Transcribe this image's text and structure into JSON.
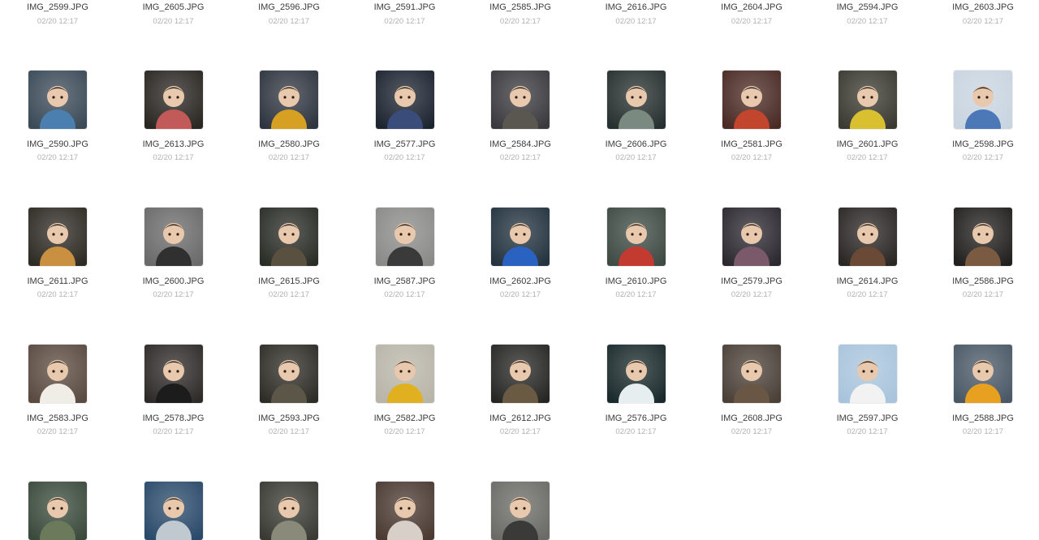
{
  "colors": {
    "filename_text": "#3c3c3c",
    "timestamp_text": "#b0b0b0",
    "background": "#ffffff"
  },
  "files": [
    {
      "name": "IMG_2599.JPG",
      "time": "02/20 12:17",
      "thumb": null
    },
    {
      "name": "IMG_2605.JPG",
      "time": "02/20 12:17",
      "thumb": null
    },
    {
      "name": "IMG_2596.JPG",
      "time": "02/20 12:17",
      "thumb": null
    },
    {
      "name": "IMG_2591.JPG",
      "time": "02/20 12:17",
      "thumb": null
    },
    {
      "name": "IMG_2585.JPG",
      "time": "02/20 12:17",
      "thumb": null
    },
    {
      "name": "IMG_2616.JPG",
      "time": "02/20 12:17",
      "thumb": null
    },
    {
      "name": "IMG_2604.JPG",
      "time": "02/20 12:17",
      "thumb": null
    },
    {
      "name": "IMG_2594.JPG",
      "time": "02/20 12:17",
      "thumb": null
    },
    {
      "name": "IMG_2603.JPG",
      "time": "02/20 12:17",
      "thumb": null
    },
    {
      "name": "IMG_2590.JPG",
      "time": "02/20 12:17",
      "thumb": {
        "bg": "#3b4a58",
        "accent": "#4a7fb0"
      }
    },
    {
      "name": "IMG_2613.JPG",
      "time": "02/20 12:17",
      "thumb": {
        "bg": "#2a2622",
        "accent": "#c25a5a"
      }
    },
    {
      "name": "IMG_2580.JPG",
      "time": "02/20 12:17",
      "thumb": {
        "bg": "#2f3540",
        "accent": "#d6a022"
      }
    },
    {
      "name": "IMG_2577.JPG",
      "time": "02/20 12:17",
      "thumb": {
        "bg": "#1c2430",
        "accent": "#3a4c7a"
      }
    },
    {
      "name": "IMG_2584.JPG",
      "time": "02/20 12:17",
      "thumb": {
        "bg": "#3a3a3e",
        "accent": "#5a5650"
      }
    },
    {
      "name": "IMG_2606.JPG",
      "time": "02/20 12:17",
      "thumb": {
        "bg": "#26302e",
        "accent": "#7a8a80"
      }
    },
    {
      "name": "IMG_2581.JPG",
      "time": "02/20 12:17",
      "thumb": {
        "bg": "#4a2a24",
        "accent": "#c2452e"
      }
    },
    {
      "name": "IMG_2601.JPG",
      "time": "02/20 12:17",
      "thumb": {
        "bg": "#3a3a32",
        "accent": "#d8c030"
      }
    },
    {
      "name": "IMG_2598.JPG",
      "time": "02/20 12:17",
      "thumb": {
        "bg": "#c8d4e0",
        "accent": "#4c78b8"
      }
    },
    {
      "name": "IMG_2611.JPG",
      "time": "02/20 12:17",
      "thumb": {
        "bg": "#2e2a24",
        "accent": "#c89040"
      }
    },
    {
      "name": "IMG_2600.JPG",
      "time": "02/20 12:17",
      "thumb": {
        "bg": "#6a6a6a",
        "accent": "#303030"
      }
    },
    {
      "name": "IMG_2615.JPG",
      "time": "02/20 12:17",
      "thumb": {
        "bg": "#2a2c26",
        "accent": "#5a5040"
      }
    },
    {
      "name": "IMG_2587.JPG",
      "time": "02/20 12:17",
      "thumb": {
        "bg": "#8a8a88",
        "accent": "#3a3a3a"
      }
    },
    {
      "name": "IMG_2602.JPG",
      "time": "02/20 12:17",
      "thumb": {
        "bg": "#23333f",
        "accent": "#2a62c2"
      }
    },
    {
      "name": "IMG_2610.JPG",
      "time": "02/20 12:17",
      "thumb": {
        "bg": "#3e4a44",
        "accent": "#c23a30"
      }
    },
    {
      "name": "IMG_2579.JPG",
      "time": "02/20 12:17",
      "thumb": {
        "bg": "#2c2830",
        "accent": "#7a5a6a"
      }
    },
    {
      "name": "IMG_2614.JPG",
      "time": "02/20 12:17",
      "thumb": {
        "bg": "#2a2624",
        "accent": "#6a4a36"
      }
    },
    {
      "name": "IMG_2586.JPG",
      "time": "02/20 12:17",
      "thumb": {
        "bg": "#22201e",
        "accent": "#7a5a40"
      }
    },
    {
      "name": "IMG_2583.JPG",
      "time": "02/20 12:17",
      "thumb": {
        "bg": "#5a4a40",
        "accent": "#f0ece6"
      }
    },
    {
      "name": "IMG_2578.JPG",
      "time": "02/20 12:17",
      "thumb": {
        "bg": "#2e2a28",
        "accent": "#1c1c1c"
      }
    },
    {
      "name": "IMG_2593.JPG",
      "time": "02/20 12:17",
      "thumb": {
        "bg": "#2e2c26",
        "accent": "#5c5648"
      }
    },
    {
      "name": "IMG_2582.JPG",
      "time": "02/20 12:17",
      "thumb": {
        "bg": "#b8b4a8",
        "accent": "#e0b020"
      }
    },
    {
      "name": "IMG_2612.JPG",
      "time": "02/20 12:17",
      "thumb": {
        "bg": "#262624",
        "accent": "#6a5a44"
      }
    },
    {
      "name": "IMG_2576.JPG",
      "time": "02/20 12:17",
      "thumb": {
        "bg": "#1a2a2c",
        "accent": "#e6eef0"
      }
    },
    {
      "name": "IMG_2608.JPG",
      "time": "02/20 12:17",
      "thumb": {
        "bg": "#4a4038",
        "accent": "#6a5644"
      }
    },
    {
      "name": "IMG_2597.JPG",
      "time": "02/20 12:17",
      "thumb": {
        "bg": "#a8c4dc",
        "accent": "#f2f2f2"
      }
    },
    {
      "name": "IMG_2588.JPG",
      "time": "02/20 12:17",
      "thumb": {
        "bg": "#4a5866",
        "accent": "#e8a020"
      }
    },
    {
      "name": "",
      "time": "",
      "thumb": {
        "bg": "#3a4a3c",
        "accent": "#6a7a5a"
      }
    },
    {
      "name": "",
      "time": "",
      "thumb": {
        "bg": "#2a4a6a",
        "accent": "#c0c8d0"
      }
    },
    {
      "name": "",
      "time": "",
      "thumb": {
        "bg": "#3a3a34",
        "accent": "#8a8a7a"
      }
    },
    {
      "name": "",
      "time": "",
      "thumb": {
        "bg": "#4a3a32",
        "accent": "#d8d0c8"
      }
    },
    {
      "name": "",
      "time": "",
      "thumb": {
        "bg": "#6a6a66",
        "accent": "#3a3a38"
      }
    }
  ]
}
